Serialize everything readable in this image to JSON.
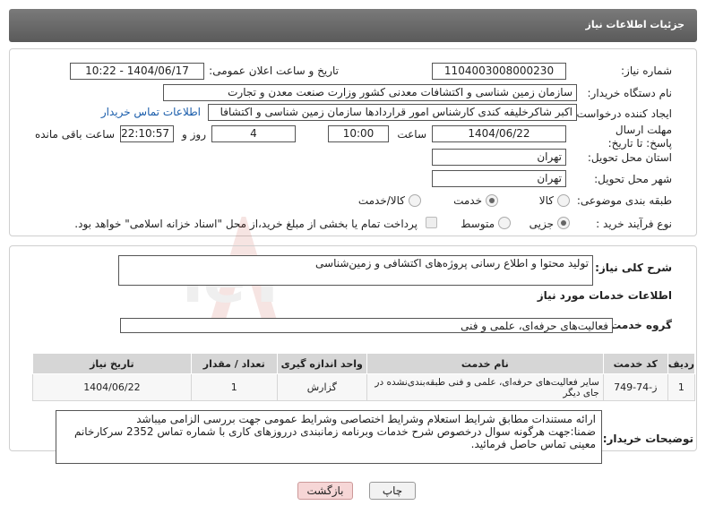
{
  "header": {
    "title": "جزئیات اطلاعات نیاز"
  },
  "fields": {
    "need_number_label": "شماره نیاز:",
    "need_number": "1104003008000230",
    "announce_label": "تاریخ و ساعت اعلان عمومی:",
    "announce_value": "1404/06/17 - 10:22",
    "buyer_label": "نام دستگاه خریدار:",
    "buyer_value": "سازمان زمین شناسی و اکتشافات معدنی کشور وزارت صنعت معدن و تجارت",
    "creator_label": "ایجاد کننده درخواست:",
    "creator_value": "اکبر شاکرخلیفه کندی کارشناس امور قراردادها سازمان زمین شناسی و اکتشافا",
    "contact_link": "اطلاعات تماس خریدار",
    "deadline_label": "مهلت ارسال پاسخ: تا تاریخ:",
    "deadline_date": "1404/06/22",
    "time_label": "ساعت",
    "deadline_time": "10:00",
    "days_value": "4",
    "days_label": "روز و",
    "remaining_time": "22:10:57",
    "remaining_label": "ساعت باقی مانده",
    "province_label": "استان محل تحویل:",
    "province_value": "تهران",
    "city_label": "شهر محل تحویل:",
    "city_value": "تهران",
    "category_label": "طبقه بندی موضوعی:",
    "category_options": [
      "کالا",
      "خدمت",
      "کالا/خدمت"
    ],
    "category_selected": "خدمت",
    "process_label": "نوع فرآیند خرید :",
    "process_options": [
      "جزیی",
      "متوسط"
    ],
    "process_selected": "جزیی",
    "payment_note": "پرداخت تمام یا بخشی از مبلغ خرید،از محل \"اسناد خزانه اسلامی\" خواهد بود."
  },
  "description": {
    "label": "شرح کلی نیاز:",
    "value": "تولید محتوا و اطلاع رسانی پروژه‌های اکتشافی و زمین‌شناسی"
  },
  "services": {
    "section_title": "اطلاعات خدمات مورد نیاز",
    "group_label": "گروه خدمت:",
    "group_value": "فعالیت‌های حرفه‌ای، علمی و فنی",
    "columns": [
      "ردیف",
      "کد خدمت",
      "نام خدمت",
      "واحد اندازه گیری",
      "تعداد / مقدار",
      "تاریخ نیاز"
    ],
    "rows": [
      {
        "row": "1",
        "code": "ز-74-749",
        "name": "سایر فعالیت‌های حرفه‌ای، علمی و فنی طبقه‌بندی‌نشده در جای دیگر",
        "unit": "گزارش",
        "qty": "1",
        "date": "1404/06/22"
      }
    ]
  },
  "buyer_notes": {
    "label": "توضیحات خریدار:",
    "line1": "ارائه مستندات مطابق شرایط استعلام وشرایط اختصاصی وشرایط عمومی جهت بررسی الزامی میباشد",
    "line2": "ضمنا:جهت هرگونه سوال درخصوص شرح خدمات وبرنامه زمانبندی درروزهای کاری با شماره تماس 2352 سرکارخانم معینی تماس حاصل فرمائید."
  },
  "buttons": {
    "print": "چاپ",
    "back": "بازگشت"
  },
  "watermark": {
    "text": "AriaTender.neT"
  }
}
